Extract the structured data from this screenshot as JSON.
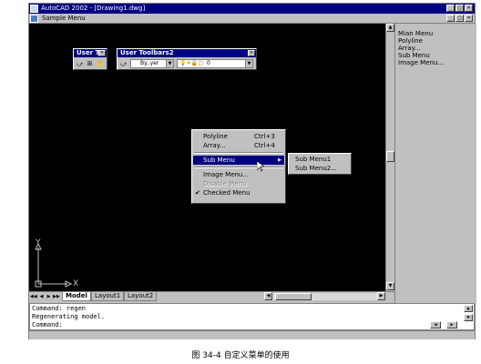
{
  "window": {
    "title": "AutoCAD 2002 - [Drawing1.dwg]",
    "controls": [
      "_",
      "□",
      "×"
    ]
  },
  "menubar": {
    "menu_label": "Sample Menu",
    "doc_controls": [
      "_",
      "□",
      "×"
    ]
  },
  "toolbars": {
    "user_toolbar": {
      "title": "User T"
    },
    "user_toolbar2": {
      "title": "User Toolbars2",
      "linetype_value": "By..yer",
      "layer_value": "0"
    }
  },
  "context_menu": {
    "items": [
      {
        "label": "Polyline",
        "shortcut": "Ctrl+3"
      },
      {
        "label": "Array...",
        "shortcut": "Ctrl+4"
      },
      {
        "label": "Sub Menu",
        "shortcut": ""
      },
      {
        "label": "Image Menu...",
        "shortcut": ""
      },
      {
        "label": "Disable Menu",
        "shortcut": ""
      },
      {
        "label": "Checked Menu",
        "shortcut": ""
      }
    ],
    "highlighted": "Sub Menu",
    "disabled": "Disable Menu",
    "checked": "Checked Menu",
    "check_glyph": "✔",
    "submenu_arrow": "▶"
  },
  "submenu": {
    "items": [
      "Sub Menu1",
      "Sub Menu2..."
    ]
  },
  "screen_menu": {
    "items": [
      "Mian Menu",
      "Polyline",
      "Array...",
      "Sub Menu",
      "Image Menu..."
    ]
  },
  "ucs": {
    "x_label": "X",
    "y_label": "Y"
  },
  "layout_tabs": {
    "tabs": [
      "Model",
      "Layout1",
      "Layout2"
    ],
    "active": "Model",
    "nav": [
      "◀◀",
      "◀",
      "▶",
      "▶▶"
    ]
  },
  "command_window": {
    "lines": [
      "Command: regen",
      "Regenerating model.",
      "Command:"
    ]
  },
  "colors": {
    "title_bar": "#000080",
    "drawing_bg": "#000000",
    "chrome": "#c0c0c0",
    "highlight": "#000080"
  },
  "caption": "图 34-4   自定义菜单的使用"
}
